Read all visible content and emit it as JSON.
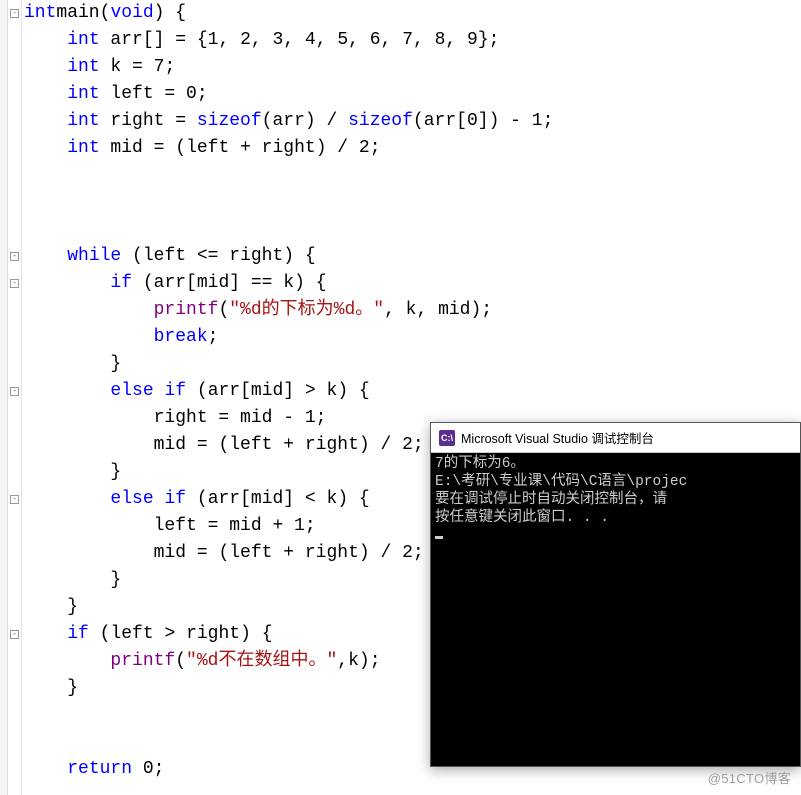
{
  "code": {
    "lines": [
      {
        "i": 0,
        "tokens": [
          [
            "kw",
            "int"
          ],
          [
            "",
            ""
          ],
          [
            "",
            "main"
          ],
          [
            "paren",
            "("
          ],
          [
            "kw",
            "void"
          ],
          [
            "paren",
            ")"
          ],
          [
            "",
            " {"
          ]
        ]
      },
      {
        "i": 1,
        "tokens": [
          [
            "",
            "    "
          ],
          [
            "kw",
            "int"
          ],
          [
            "",
            " arr[] = {"
          ],
          [
            "num",
            "1"
          ],
          [
            "",
            ", "
          ],
          [
            "num",
            "2"
          ],
          [
            "",
            ", "
          ],
          [
            "num",
            "3"
          ],
          [
            "",
            ", "
          ],
          [
            "num",
            "4"
          ],
          [
            "",
            ", "
          ],
          [
            "num",
            "5"
          ],
          [
            "",
            ", "
          ],
          [
            "num",
            "6"
          ],
          [
            "",
            ", "
          ],
          [
            "num",
            "7"
          ],
          [
            "",
            ", "
          ],
          [
            "num",
            "8"
          ],
          [
            "",
            ", "
          ],
          [
            "num",
            "9"
          ],
          [
            "",
            "};"
          ]
        ]
      },
      {
        "i": 2,
        "hl": true,
        "tokens": [
          [
            "",
            "    "
          ],
          [
            "kw",
            "int"
          ],
          [
            "",
            " k = "
          ],
          [
            "num",
            "7"
          ],
          [
            "",
            ";"
          ]
        ]
      },
      {
        "i": 3,
        "tokens": [
          [
            "",
            "    "
          ],
          [
            "kw",
            "int"
          ],
          [
            "",
            " left = "
          ],
          [
            "num",
            "0"
          ],
          [
            "",
            ";"
          ]
        ]
      },
      {
        "i": 4,
        "tokens": [
          [
            "",
            "    "
          ],
          [
            "kw",
            "int"
          ],
          [
            "",
            " right = "
          ],
          [
            "kw",
            "sizeof"
          ],
          [
            "paren",
            "("
          ],
          [
            "",
            "arr"
          ],
          [
            "paren",
            ")"
          ],
          [
            "",
            " / "
          ],
          [
            "kw",
            "sizeof"
          ],
          [
            "paren",
            "("
          ],
          [
            "",
            "arr["
          ],
          [
            "num",
            "0"
          ],
          [
            "",
            "]"
          ],
          [
            "paren",
            ")"
          ],
          [
            "",
            " - "
          ],
          [
            "num",
            "1"
          ],
          [
            "",
            ";"
          ]
        ]
      },
      {
        "i": 5,
        "tokens": [
          [
            "",
            "    "
          ],
          [
            "kw",
            "int"
          ],
          [
            "",
            " mid = "
          ],
          [
            "paren",
            "("
          ],
          [
            "",
            "left + right"
          ],
          [
            "paren",
            ")"
          ],
          [
            "",
            " / "
          ],
          [
            "num",
            "2"
          ],
          [
            "",
            ";"
          ]
        ]
      },
      {
        "i": 6,
        "tokens": [
          [
            "",
            ""
          ]
        ]
      },
      {
        "i": 7,
        "tokens": [
          [
            "",
            ""
          ]
        ]
      },
      {
        "i": 8,
        "tokens": [
          [
            "",
            ""
          ]
        ]
      },
      {
        "i": 9,
        "tokens": [
          [
            "",
            "    "
          ],
          [
            "kw",
            "while"
          ],
          [
            "",
            " "
          ],
          [
            "paren",
            "("
          ],
          [
            "",
            "left <= right"
          ],
          [
            "paren",
            ")"
          ],
          [
            "",
            " {"
          ]
        ]
      },
      {
        "i": 10,
        "tokens": [
          [
            "",
            "        "
          ],
          [
            "kw",
            "if"
          ],
          [
            "",
            " "
          ],
          [
            "paren",
            "("
          ],
          [
            "",
            "arr[mid] == k"
          ],
          [
            "paren",
            ")"
          ],
          [
            "",
            " {"
          ]
        ]
      },
      {
        "i": 11,
        "tokens": [
          [
            "",
            "            "
          ],
          [
            "fn",
            "printf"
          ],
          [
            "paren",
            "("
          ],
          [
            "str",
            "\"%d的下标为%d。\""
          ],
          [
            "",
            ", k, mid"
          ],
          [
            "paren",
            ")"
          ],
          [
            "",
            ";"
          ]
        ]
      },
      {
        "i": 12,
        "tokens": [
          [
            "",
            "            "
          ],
          [
            "kw",
            "break"
          ],
          [
            "",
            ";"
          ]
        ]
      },
      {
        "i": 13,
        "tokens": [
          [
            "",
            "        }"
          ]
        ]
      },
      {
        "i": 14,
        "tokens": [
          [
            "",
            "        "
          ],
          [
            "kw",
            "else"
          ],
          [
            "",
            " "
          ],
          [
            "kw",
            "if"
          ],
          [
            "",
            " "
          ],
          [
            "paren",
            "("
          ],
          [
            "",
            "arr[mid] > k"
          ],
          [
            "paren",
            ")"
          ],
          [
            "",
            " {"
          ]
        ]
      },
      {
        "i": 15,
        "tokens": [
          [
            "",
            "            right = mid - "
          ],
          [
            "num",
            "1"
          ],
          [
            "",
            ";"
          ]
        ]
      },
      {
        "i": 16,
        "tokens": [
          [
            "",
            "            mid = "
          ],
          [
            "paren",
            "("
          ],
          [
            "",
            "left + right"
          ],
          [
            "paren",
            ")"
          ],
          [
            "",
            " / "
          ],
          [
            "num",
            "2"
          ],
          [
            "",
            ";"
          ]
        ]
      },
      {
        "i": 17,
        "tokens": [
          [
            "",
            "        }"
          ]
        ]
      },
      {
        "i": 18,
        "tokens": [
          [
            "",
            "        "
          ],
          [
            "kw",
            "else"
          ],
          [
            "",
            " "
          ],
          [
            "kw",
            "if"
          ],
          [
            "",
            " "
          ],
          [
            "paren",
            "("
          ],
          [
            "",
            "arr[mid] < k"
          ],
          [
            "paren",
            ")"
          ],
          [
            "",
            " {"
          ]
        ]
      },
      {
        "i": 19,
        "tokens": [
          [
            "",
            "            left = mid + "
          ],
          [
            "num",
            "1"
          ],
          [
            "",
            ";"
          ]
        ]
      },
      {
        "i": 20,
        "tokens": [
          [
            "",
            "            mid = "
          ],
          [
            "paren",
            "("
          ],
          [
            "",
            "left + right"
          ],
          [
            "paren",
            ")"
          ],
          [
            "",
            " / "
          ],
          [
            "num",
            "2"
          ],
          [
            "",
            ";"
          ]
        ]
      },
      {
        "i": 21,
        "tokens": [
          [
            "",
            "        }"
          ]
        ]
      },
      {
        "i": 22,
        "tokens": [
          [
            "",
            "    }"
          ]
        ]
      },
      {
        "i": 23,
        "tokens": [
          [
            "",
            "    "
          ],
          [
            "kw",
            "if"
          ],
          [
            "",
            " "
          ],
          [
            "paren",
            "("
          ],
          [
            "",
            "left > right"
          ],
          [
            "paren",
            ")"
          ],
          [
            "",
            " {"
          ]
        ]
      },
      {
        "i": 24,
        "tokens": [
          [
            "",
            "        "
          ],
          [
            "fn",
            "printf"
          ],
          [
            "paren",
            "("
          ],
          [
            "str",
            "\"%d不在数组中。\""
          ],
          [
            "",
            ",k"
          ],
          [
            "paren",
            ")"
          ],
          [
            "",
            ";"
          ]
        ]
      },
      {
        "i": 25,
        "tokens": [
          [
            "",
            "    }"
          ]
        ]
      },
      {
        "i": 26,
        "tokens": [
          [
            "",
            ""
          ]
        ]
      },
      {
        "i": 27,
        "tokens": [
          [
            "",
            ""
          ]
        ]
      },
      {
        "i": 28,
        "tokens": [
          [
            "",
            "    "
          ],
          [
            "kw",
            "return"
          ],
          [
            "",
            " "
          ],
          [
            "num",
            "0"
          ],
          [
            "",
            ";"
          ]
        ]
      }
    ],
    "fold_rows": [
      0,
      9,
      10,
      14,
      18,
      23
    ]
  },
  "console": {
    "title": "Microsoft Visual Studio 调试控制台",
    "icon_text": "C:\\",
    "lines": [
      "7的下标为6。",
      "E:\\考研\\专业课\\代码\\C语言\\projec",
      "要在调试停止时自动关闭控制台，请",
      "按任意键关闭此窗口. . ."
    ]
  },
  "watermark": "@51CTO博客"
}
